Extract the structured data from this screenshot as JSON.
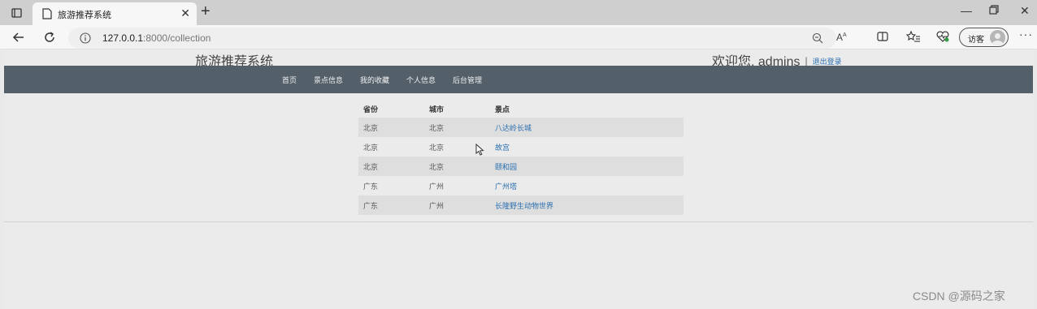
{
  "browser": {
    "tab_title": "旅游推荐系统",
    "address": {
      "host": "127.0.0.1",
      "path": ":8000/collection"
    },
    "profile_label": "访客"
  },
  "site": {
    "title": "旅游推荐系统",
    "welcome": "欢迎您, admins",
    "separator": "|",
    "logout": "退出登录",
    "nav": [
      "首页",
      "景点信息",
      "我的收藏",
      "个人信息",
      "后台管理"
    ]
  },
  "table": {
    "headers": [
      "省份",
      "城市",
      "景点"
    ],
    "rows": [
      [
        "北京",
        "北京",
        "八达岭长城"
      ],
      [
        "北京",
        "北京",
        "故宫"
      ],
      [
        "北京",
        "北京",
        "颐和园"
      ],
      [
        "广东",
        "广州",
        "广州塔"
      ],
      [
        "广东",
        "广州",
        "长隆野生动物世界"
      ]
    ]
  },
  "watermark": "CSDN @源码之家",
  "colors": {
    "navbar": "#535f69",
    "link": "#2a6fb0",
    "tabbar": "#cfcfcf"
  }
}
